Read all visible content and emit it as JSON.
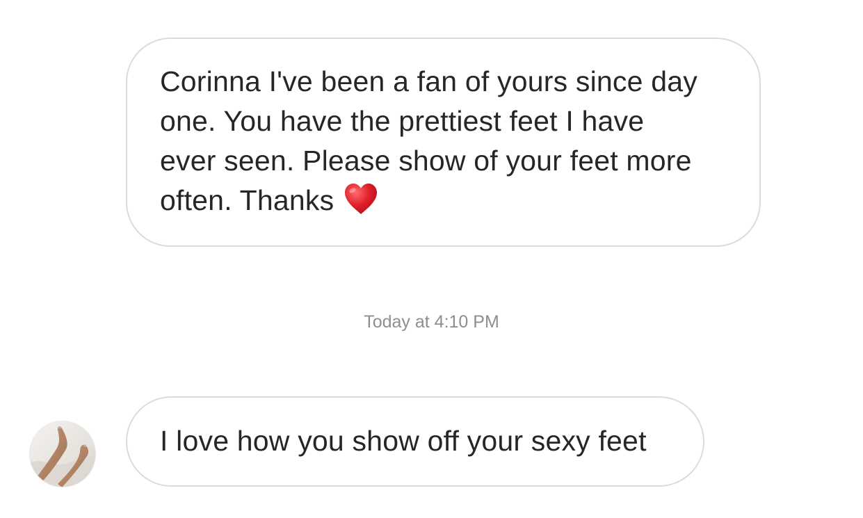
{
  "thread": {
    "incoming_message_1": {
      "lines": [
        "Corinna I've been a fan of yours since day",
        "one. You have the prettiest feet I have",
        "ever seen. Please show of your feet more",
        "often. Thanks"
      ],
      "emoji": "red-heart"
    },
    "timestamp": "Today at 4:10 PM",
    "incoming_message_2": {
      "text": "I love how you show off your sexy feet"
    }
  },
  "colors": {
    "bubble_border": "#dbdbdb",
    "text": "#262626",
    "timestamp": "#8e8e8e",
    "heart": "#e0202a"
  }
}
